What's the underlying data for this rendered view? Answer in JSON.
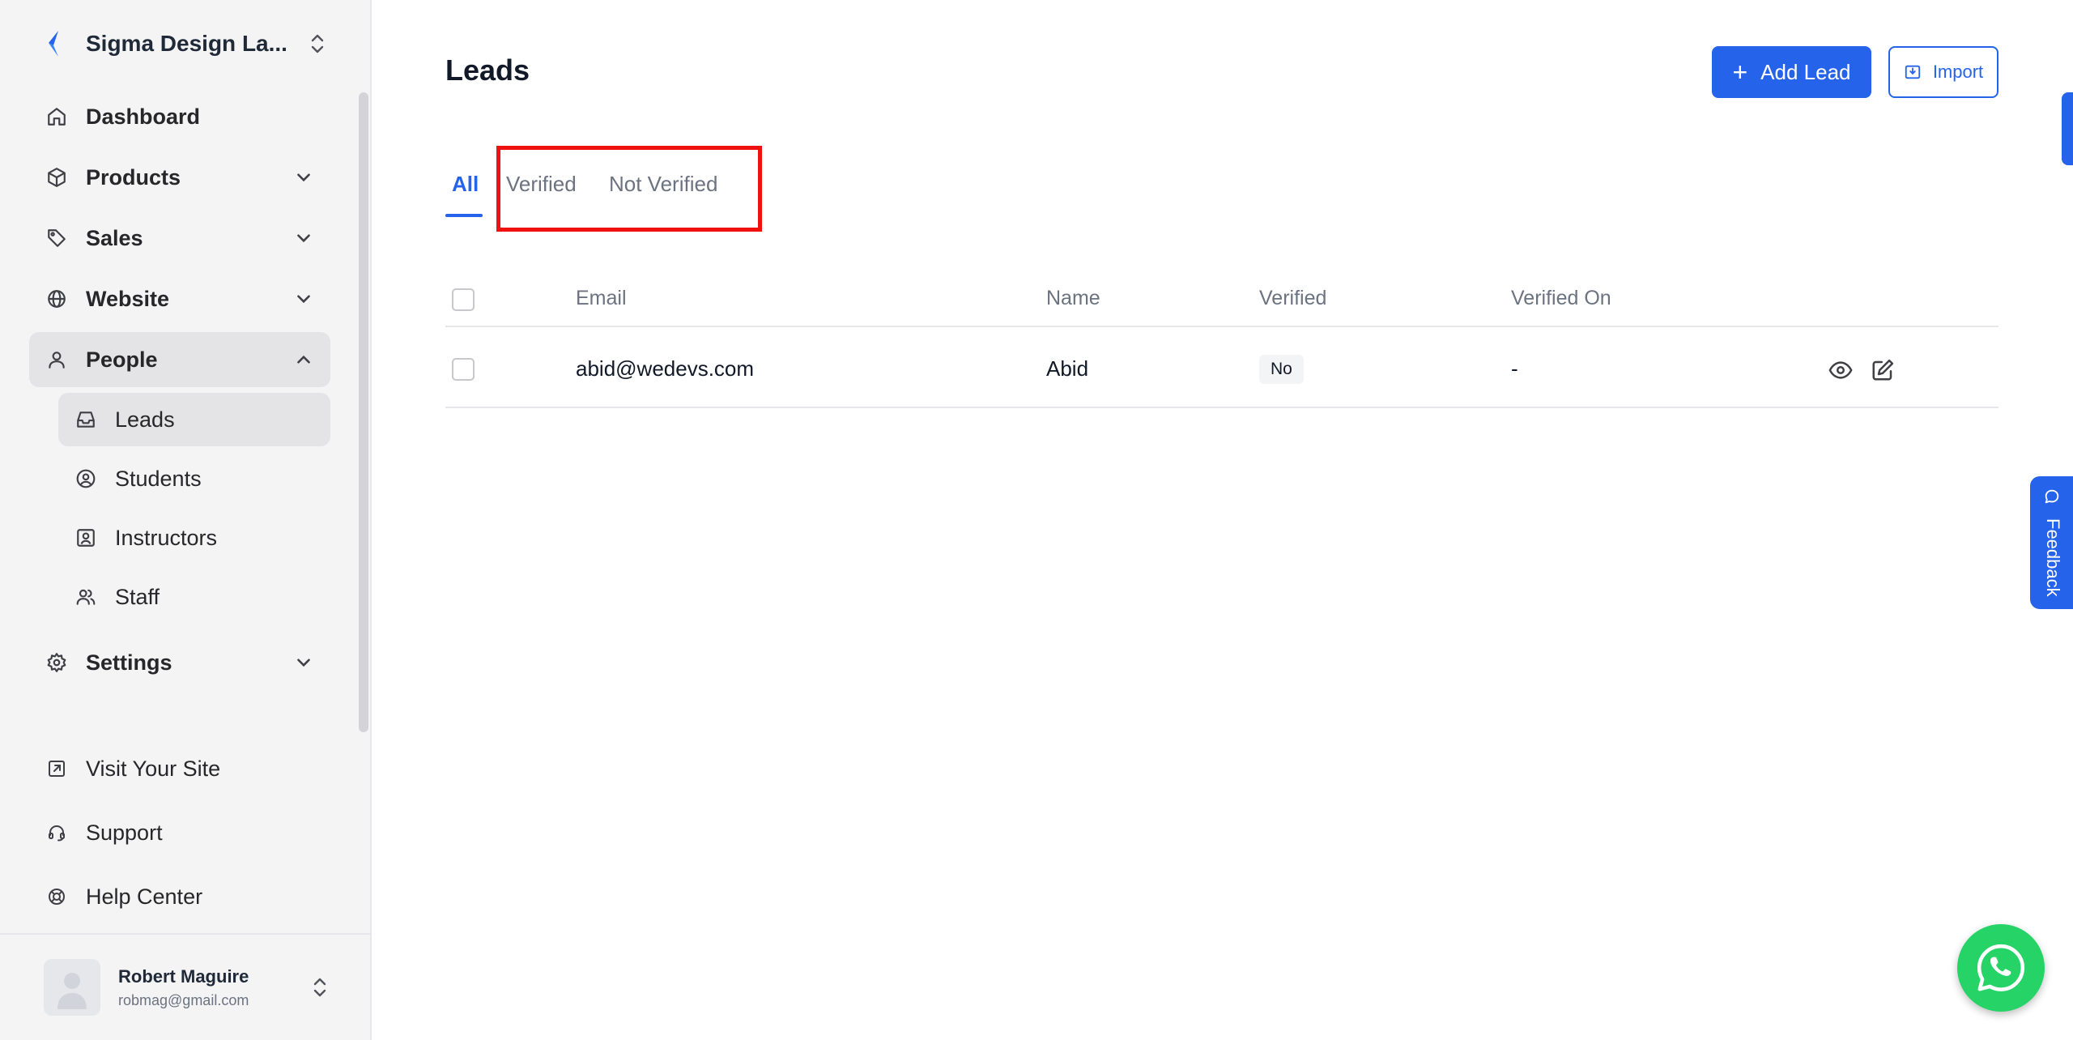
{
  "workspace": {
    "name": "Sigma Design La..."
  },
  "nav": {
    "dashboard": "Dashboard",
    "products": "Products",
    "sales": "Sales",
    "website": "Website",
    "people": "People",
    "people_children": {
      "leads": "Leads",
      "students": "Students",
      "instructors": "Instructors",
      "staff": "Staff"
    },
    "settings": "Settings"
  },
  "bottom_links": {
    "visit_site": "Visit Your Site",
    "support": "Support",
    "help_center": "Help Center"
  },
  "user": {
    "name": "Robert Maguire",
    "email": "robmag@gmail.com"
  },
  "page": {
    "title": "Leads",
    "add_button": "Add Lead",
    "add_button_icon": "+",
    "import_button": "Import"
  },
  "tabs": {
    "all": "All",
    "verified": "Verified",
    "not_verified": "Not Verified",
    "active": "All"
  },
  "table": {
    "columns": {
      "email": "Email",
      "name": "Name",
      "verified": "Verified",
      "verified_on": "Verified On"
    },
    "rows": [
      {
        "email": "abid@wedevs.com",
        "name": "Abid",
        "verified": "No",
        "verified_on": "-"
      }
    ]
  },
  "feedback": {
    "label": "Feedback"
  },
  "colors": {
    "accent": "#2563eb",
    "highlight": "#ef1010",
    "whatsapp": "#25d366"
  }
}
